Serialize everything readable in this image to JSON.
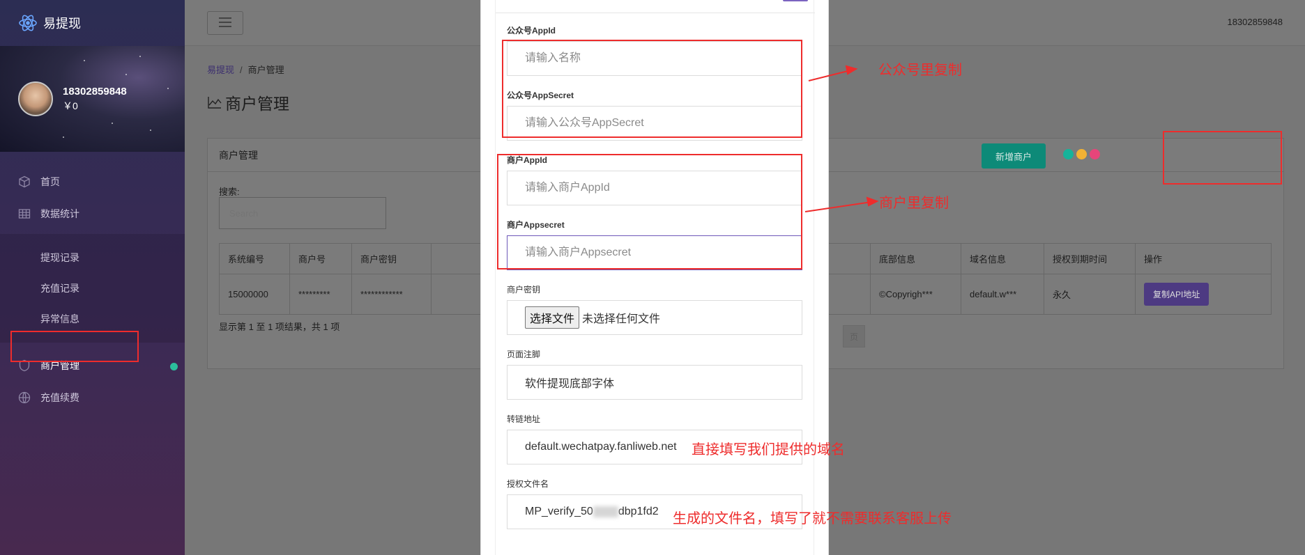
{
  "app": {
    "name": "易提现",
    "user_phone": "18302859848"
  },
  "profile": {
    "name": "18302859848",
    "balance": "￥0"
  },
  "sidebar": {
    "items": [
      {
        "label": "首页",
        "icon": "cube-icon"
      },
      {
        "label": "数据统计",
        "icon": "table-icon"
      }
    ],
    "sub_items": [
      "提现记录",
      "充值记录",
      "异常信息"
    ],
    "active": {
      "label": "商户管理",
      "icon": "shield-icon"
    },
    "last": {
      "label": "充值续费",
      "icon": "globe-icon"
    }
  },
  "breadcrumb": {
    "home": "易提现",
    "sep": "/",
    "current": "商户管理"
  },
  "page_title": "商户管理",
  "card": {
    "title": "商户管理",
    "add_button": "新增商户",
    "search_label": "搜索:",
    "search_placeholder": "Search",
    "columns": [
      "系统编号",
      "商户号",
      "商户密钥",
      "",
      "",
      "底部信息",
      "域名信息",
      "授权到期时间",
      "操作"
    ],
    "row": {
      "id": "15000000",
      "merchant_no": "*********",
      "merchant_key": "************",
      "footer": "©Copyrigh***",
      "domain": "default.w***",
      "expire": "永久",
      "action": "复制API地址"
    },
    "page_info": "显示第 1 至 1 项结果，共 1 项",
    "page_btn": "页"
  },
  "colors": {
    "accent": "#6d57b8",
    "primary": "#7b63c0",
    "success": "#16b39a",
    "annotation": "#ee2c2c"
  },
  "dots": [
    "#16b39a",
    "#f2b233",
    "#e6457a"
  ],
  "modal": {
    "fields": [
      {
        "label": "公众号AppId",
        "placeholder": "请输入名称",
        "value": ""
      },
      {
        "label": "公众号AppSecret",
        "placeholder": "请输入公众号AppSecret",
        "value": ""
      },
      {
        "label": "商户AppId",
        "placeholder": "请输入商户AppId",
        "value": ""
      },
      {
        "label": "商户Appsecret",
        "placeholder": "请输入商户Appsecret",
        "value": ""
      },
      {
        "label": "商户密钥",
        "file_button": "选择文件",
        "file_status": "未选择任何文件"
      },
      {
        "label": "页面注脚",
        "placeholder": "",
        "value": "软件提现底部字体"
      },
      {
        "label": "转链地址",
        "placeholder": "",
        "value": "default.wechatpay.fanliweb.net"
      },
      {
        "label": "授权文件名",
        "value_prefix": "MP_verify_50",
        "value_suffix": "dbp1fd2"
      }
    ]
  },
  "annotations": [
    "公众号里复制",
    "商户里复制",
    "直接填写我们提供的域名",
    "生成的文件名，填写了就不需要联系客服上传"
  ]
}
